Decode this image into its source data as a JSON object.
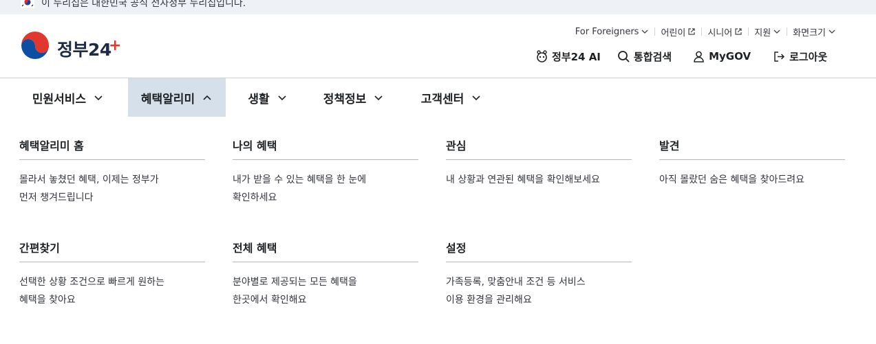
{
  "notice": {
    "text": "이 누리집은 대한민국 공식 전자정부 누리집입니다."
  },
  "logo": {
    "brand": "정부24"
  },
  "util_links": [
    {
      "label": "For Foreigners",
      "icon": "chevron-down-icon"
    },
    {
      "label": "어린이",
      "icon": "external-link-icon"
    },
    {
      "label": "시니어",
      "icon": "external-link-icon"
    },
    {
      "label": "지원",
      "icon": "chevron-down-icon"
    },
    {
      "label": "화면크기",
      "icon": "chevron-down-icon"
    }
  ],
  "main_util": [
    {
      "label": "정부24 AI",
      "icon": "ai-bot-icon"
    },
    {
      "label": "통합검색",
      "icon": "search-icon"
    },
    {
      "label": "MyGOV",
      "icon": "user-icon"
    },
    {
      "label": "로그아웃",
      "icon": "logout-icon"
    }
  ],
  "gnb": [
    {
      "label": "민원서비스",
      "expanded": false
    },
    {
      "label": "혜택알리미",
      "expanded": true
    },
    {
      "label": "생활",
      "expanded": false
    },
    {
      "label": "정책정보",
      "expanded": false
    },
    {
      "label": "고객센터",
      "expanded": false
    }
  ],
  "mega_menu": [
    {
      "title": "혜택알리미 홈",
      "desc": "몰라서 놓쳤던 혜택, 이제는 정부가\n먼저 챙겨드립니다"
    },
    {
      "title": "나의 혜택",
      "desc": "내가 받을 수 있는 혜택을 한 눈에\n확인하세요"
    },
    {
      "title": "관심",
      "desc": "내 상황과 연관된 혜택을 확인해보세요"
    },
    {
      "title": "발견",
      "desc": "아직 몰랐던 숨은 혜택을 찾아드려요"
    },
    {
      "title": "간편찾기",
      "desc": "선택한 상황 조건으로 빠르게 원하는\n혜택을 찾아요"
    },
    {
      "title": "전체 혜택",
      "desc": "분야별로 제공되는 모든 혜택을\n한곳에서 확인해요"
    },
    {
      "title": "설정",
      "desc": "가족등록, 맞춤안내 조건 등 서비스\n이용 환경을 관리해요"
    }
  ],
  "colors": {
    "active_tab_bg": "#d6e0eb",
    "brand_blue": "#0b4ea2",
    "brand_red": "#e0382c",
    "notice_bg": "#eef2f7"
  }
}
